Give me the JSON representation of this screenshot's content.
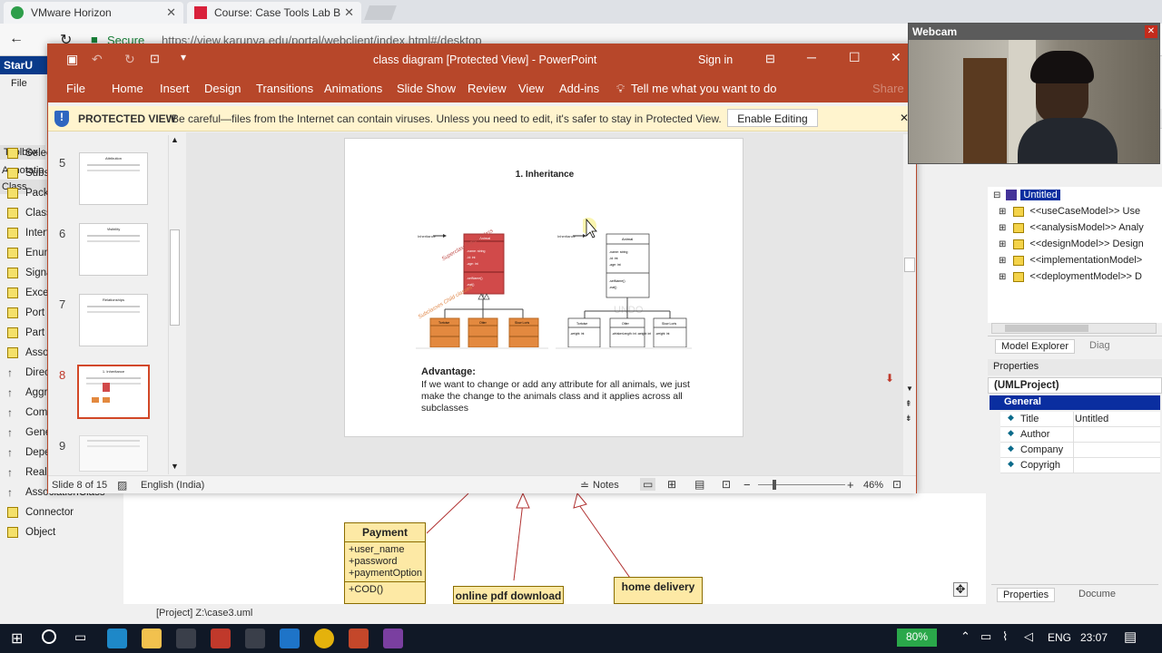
{
  "chrome": {
    "tab1": "VMware Horizon",
    "tab2": "Course: Case Tools Lab B",
    "secure": "Secure",
    "url": "https://view.karunya.edu/portal/webclient/index.html#/desktop"
  },
  "staruml": {
    "app_title": "StarU",
    "menu": [
      "File",
      "Edi"
    ],
    "toolbox": "Toolbox",
    "annotation": "Annotatio",
    "class_label": "Class",
    "sidebar": [
      "Selec",
      "Subsy",
      "Packa",
      "Class",
      "Interf",
      "Enum",
      "Signa",
      "Excep",
      "Port",
      "Part",
      "Assoc",
      "Direct",
      "Aggre",
      "Comp",
      "Gener",
      "Dependency",
      "Realization",
      "AssociationClass",
      "Connector",
      "Object"
    ],
    "status_path": "[Project] Z:\\case3.uml",
    "diagram": {
      "payment_title": "Payment",
      "payment_attrs": [
        "+user_name",
        "+password",
        "+paymentOption"
      ],
      "payment_op": "+COD()",
      "pdf": "online pdf download",
      "home": "home delivery"
    }
  },
  "ppt": {
    "title": "class diagram [Protected View]  -  PowerPoint",
    "sign_in": "Sign in",
    "menu": [
      "File",
      "Home",
      "Insert",
      "Design",
      "Transitions",
      "Animations",
      "Slide Show",
      "Review",
      "View",
      "Add-ins"
    ],
    "tell_me": "Tell me what you want to do",
    "share": "Share",
    "pv_label": "PROTECTED VIEW",
    "pv_text": "Be careful—files from the Internet can contain viruses. Unless you need to edit, it's safer to stay in Protected View.",
    "enable_editing": "Enable Editing",
    "thumbs": [
      {
        "num": "5",
        "title": "Attribution"
      },
      {
        "num": "6",
        "title": "Visibility"
      },
      {
        "num": "7",
        "title": "Relationships"
      },
      {
        "num": "8",
        "title": "1. Inheritance"
      },
      {
        "num": "9",
        "title": ""
      }
    ],
    "slide": {
      "title": "1. Inheritance",
      "adv_title": "Advantage:",
      "adv_text": "If we want to change or add any attribute for all animals, we just make the change to the animals class and it applies across all subclasses",
      "left": {
        "arrow": "Inheritance",
        "class": "Animal",
        "attrs": [
          "-name: string",
          "-id: int",
          "-age: int"
        ],
        "ops": [
          "-setName()",
          "-eat()"
        ],
        "superclass": "Superclass Parent class",
        "subclasses": "Subclasses Child classes",
        "subs": [
          "Tortoise",
          "Otter",
          "Slow Loris"
        ]
      },
      "right": {
        "arrow": "Inheritance",
        "class": "Animal",
        "attrs": [
          "-name: string",
          "-id: int",
          "-age: int"
        ],
        "ops": [
          "-setName()",
          "-eat()"
        ],
        "watermark": "UNDO",
        "subs": [
          "Tortoise",
          "Otter",
          "Slow Loris"
        ],
        "sub_attrs": [
          "-weight: int",
          "-whiskerLength: int\n-weight: int",
          "-weight: int"
        ]
      }
    },
    "status": {
      "slide": "Slide 8 of 15",
      "lang": "English (India)",
      "notes": "Notes",
      "zoom": "46%"
    }
  },
  "right_panel": {
    "tree_root": "Untitled",
    "tree": [
      "<<useCaseModel>> Use",
      "<<analysisModel>> Analy",
      "<<designModel>> Design",
      "<<implementationModel>",
      "<<deploymentModel>> D"
    ],
    "tab_explorer": "Model Explorer",
    "tab_diag": "Diag",
    "properties": "Properties",
    "proj": "(UMLProject)",
    "general": "General",
    "props": [
      {
        "k": "Title",
        "v": "Untitled"
      },
      {
        "k": "Author",
        "v": ""
      },
      {
        "k": "Company",
        "v": ""
      },
      {
        "k": "Copyrigh",
        "v": ""
      }
    ],
    "bottom_tab1": "Properties",
    "bottom_tab2": "Docume"
  },
  "webcam": {
    "title": "Webcam"
  },
  "taskbar": {
    "battery": "80%",
    "lang": "ENG",
    "time": "23:07"
  }
}
